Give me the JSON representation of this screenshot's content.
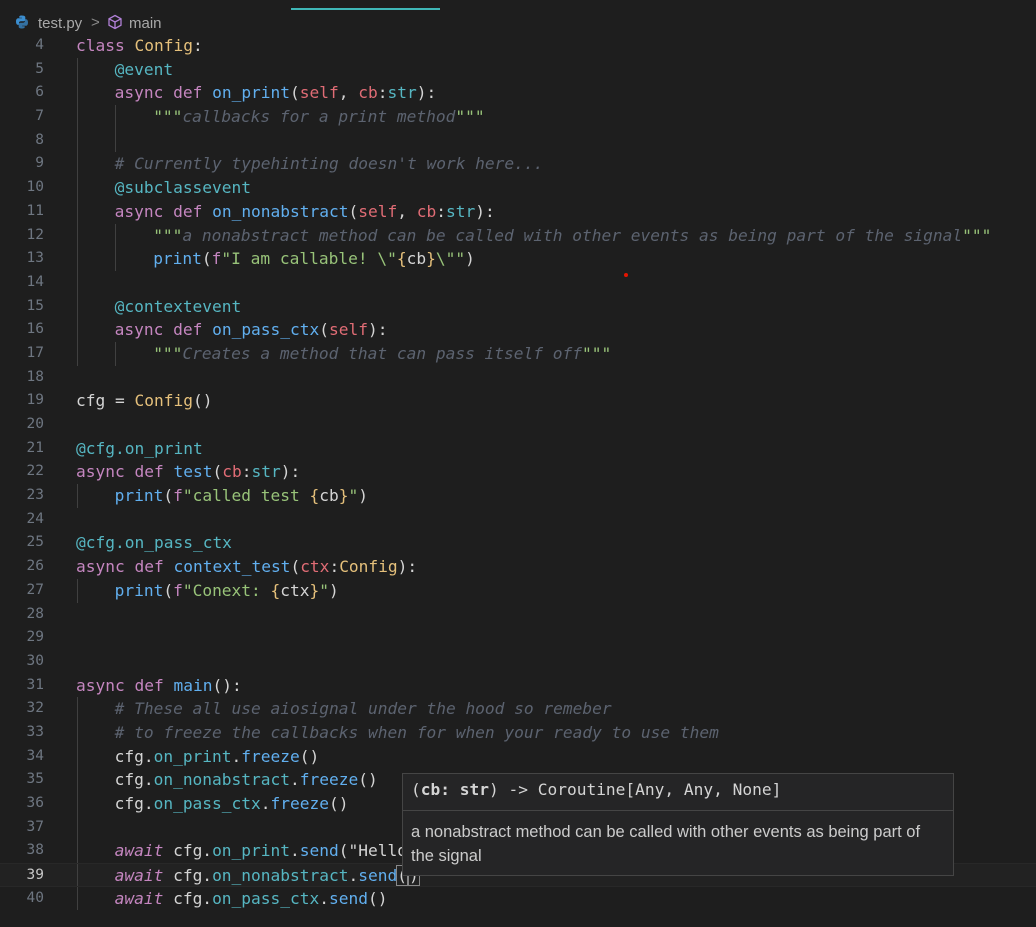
{
  "breadcrumb": {
    "file": "test.py",
    "separator": ">",
    "symbol": "main"
  },
  "hover": {
    "param": "cb: str",
    "signature_rest": " -> Coroutine[Any, Any, None]",
    "doc": "a nonabstract method can be called with other events as being part of the signal"
  },
  "lines": [
    {
      "n": "4",
      "t": "class Config:"
    },
    {
      "n": "5",
      "t": "@event"
    },
    {
      "n": "6",
      "t": "async def on_print(self, cb:str):"
    },
    {
      "n": "7",
      "t": "\"\"\"callbacks for a print method\"\"\""
    },
    {
      "n": "8",
      "t": ""
    },
    {
      "n": "9",
      "t": "# Currently typehinting doesn't work here..."
    },
    {
      "n": "10",
      "t": "@subclassevent"
    },
    {
      "n": "11",
      "t": "async def on_nonabstract(self, cb:str):"
    },
    {
      "n": "12",
      "t": "\"\"\"a nonabstract method can be called with other events as being part of the signal\"\"\""
    },
    {
      "n": "13",
      "t": "print(f\"I am callable! \\\"{cb}\\\"\")"
    },
    {
      "n": "14",
      "t": ""
    },
    {
      "n": "15",
      "t": "@contextevent"
    },
    {
      "n": "16",
      "t": "async def on_pass_ctx(self):"
    },
    {
      "n": "17",
      "t": "\"\"\"Creates a method that can pass itself off\"\"\""
    },
    {
      "n": "18",
      "t": ""
    },
    {
      "n": "19",
      "t": "cfg = Config()"
    },
    {
      "n": "20",
      "t": ""
    },
    {
      "n": "21",
      "t": "@cfg.on_print"
    },
    {
      "n": "22",
      "t": "async def test(cb:str):"
    },
    {
      "n": "23",
      "t": "print(f\"called test {cb}\")"
    },
    {
      "n": "24",
      "t": ""
    },
    {
      "n": "25",
      "t": "@cfg.on_pass_ctx"
    },
    {
      "n": "26",
      "t": "async def context_test(ctx:Config):"
    },
    {
      "n": "27",
      "t": "print(f\"Conext: {ctx}\")"
    },
    {
      "n": "28",
      "t": ""
    },
    {
      "n": "29",
      "t": ""
    },
    {
      "n": "30",
      "t": ""
    },
    {
      "n": "31",
      "t": "async def main():"
    },
    {
      "n": "32",
      "t": "# These all use aiosignal under the hood so remeber"
    },
    {
      "n": "33",
      "t": "# to freeze the callbacks when for when your ready to use them"
    },
    {
      "n": "34",
      "t": "cfg.on_print.freeze()"
    },
    {
      "n": "35",
      "t": "cfg.on_nonabstract.freeze()"
    },
    {
      "n": "36",
      "t": "cfg.on_pass_ctx.freeze()"
    },
    {
      "n": "37",
      "t": ""
    },
    {
      "n": "38",
      "t": "await cfg.on_print.send(\"Hello"
    },
    {
      "n": "39",
      "t": "await cfg.on_nonabstract.send()"
    },
    {
      "n": "40",
      "t": "await cfg.on_pass_ctx.send()"
    }
  ]
}
